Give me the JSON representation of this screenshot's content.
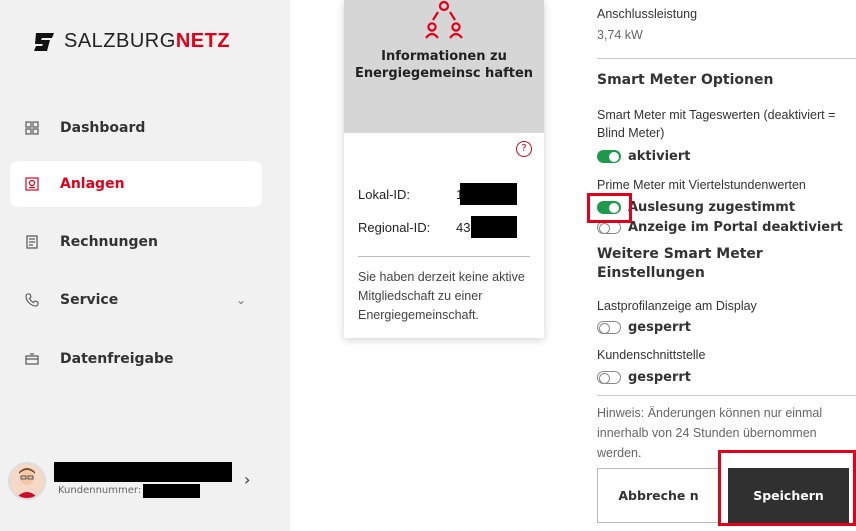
{
  "sidebar": {
    "brand_prefix": "SALZBURG",
    "brand_suffix": "NETZ",
    "items": [
      {
        "label": "Dashboard",
        "icon": "grid-icon"
      },
      {
        "label": "Anlagen",
        "icon": "meter-icon",
        "active": true
      },
      {
        "label": "Rechnungen",
        "icon": "invoice-icon"
      },
      {
        "label": "Service",
        "icon": "phone-icon"
      },
      {
        "label": "Datenfreigabe",
        "icon": "share-icon"
      }
    ],
    "customer_label": "Kundennummer:"
  },
  "card": {
    "title": "Informationen zu Energiegemeinsc haften",
    "lokal_label": "Lokal-ID:",
    "lokal_value": "1",
    "regional_label": "Regional-ID:",
    "regional_value": "43",
    "note": "Sie haben derzeit keine aktive Mitgliedschaft zu einer Energiegemeinschaft."
  },
  "panel": {
    "connection_label": "Anschlussleistung",
    "connection_value": "3,74 kW",
    "smart_heading": "Smart Meter Optionen",
    "daily_label": "Smart Meter mit Tageswerten (deaktiviert = Blind Meter)",
    "daily_toggle": "aktiviert",
    "prime_label": "Prime Meter mit Viertelstundenwerten",
    "readout_toggle": "Auslesung zugestimmt",
    "portal_toggle": "Anzeige im Portal deaktiviert",
    "more_heading": "Weitere Smart Meter Einstellungen",
    "loadprofile_label": "Lastprofilanzeige am Display",
    "loadprofile_toggle": "gesperrt",
    "interface_label": "Kundenschnittstelle",
    "interface_toggle": "gesperrt",
    "hint": "Hinweis: Änderungen können nur einmal innerhalb von 24 Stunden übernommen werden.",
    "cancel_label": "Abbreche n",
    "save_label": "Speichern"
  },
  "colors": {
    "accent": "#e2001a",
    "toggle_on": "#1d9a4b",
    "save_bg": "#303030"
  }
}
